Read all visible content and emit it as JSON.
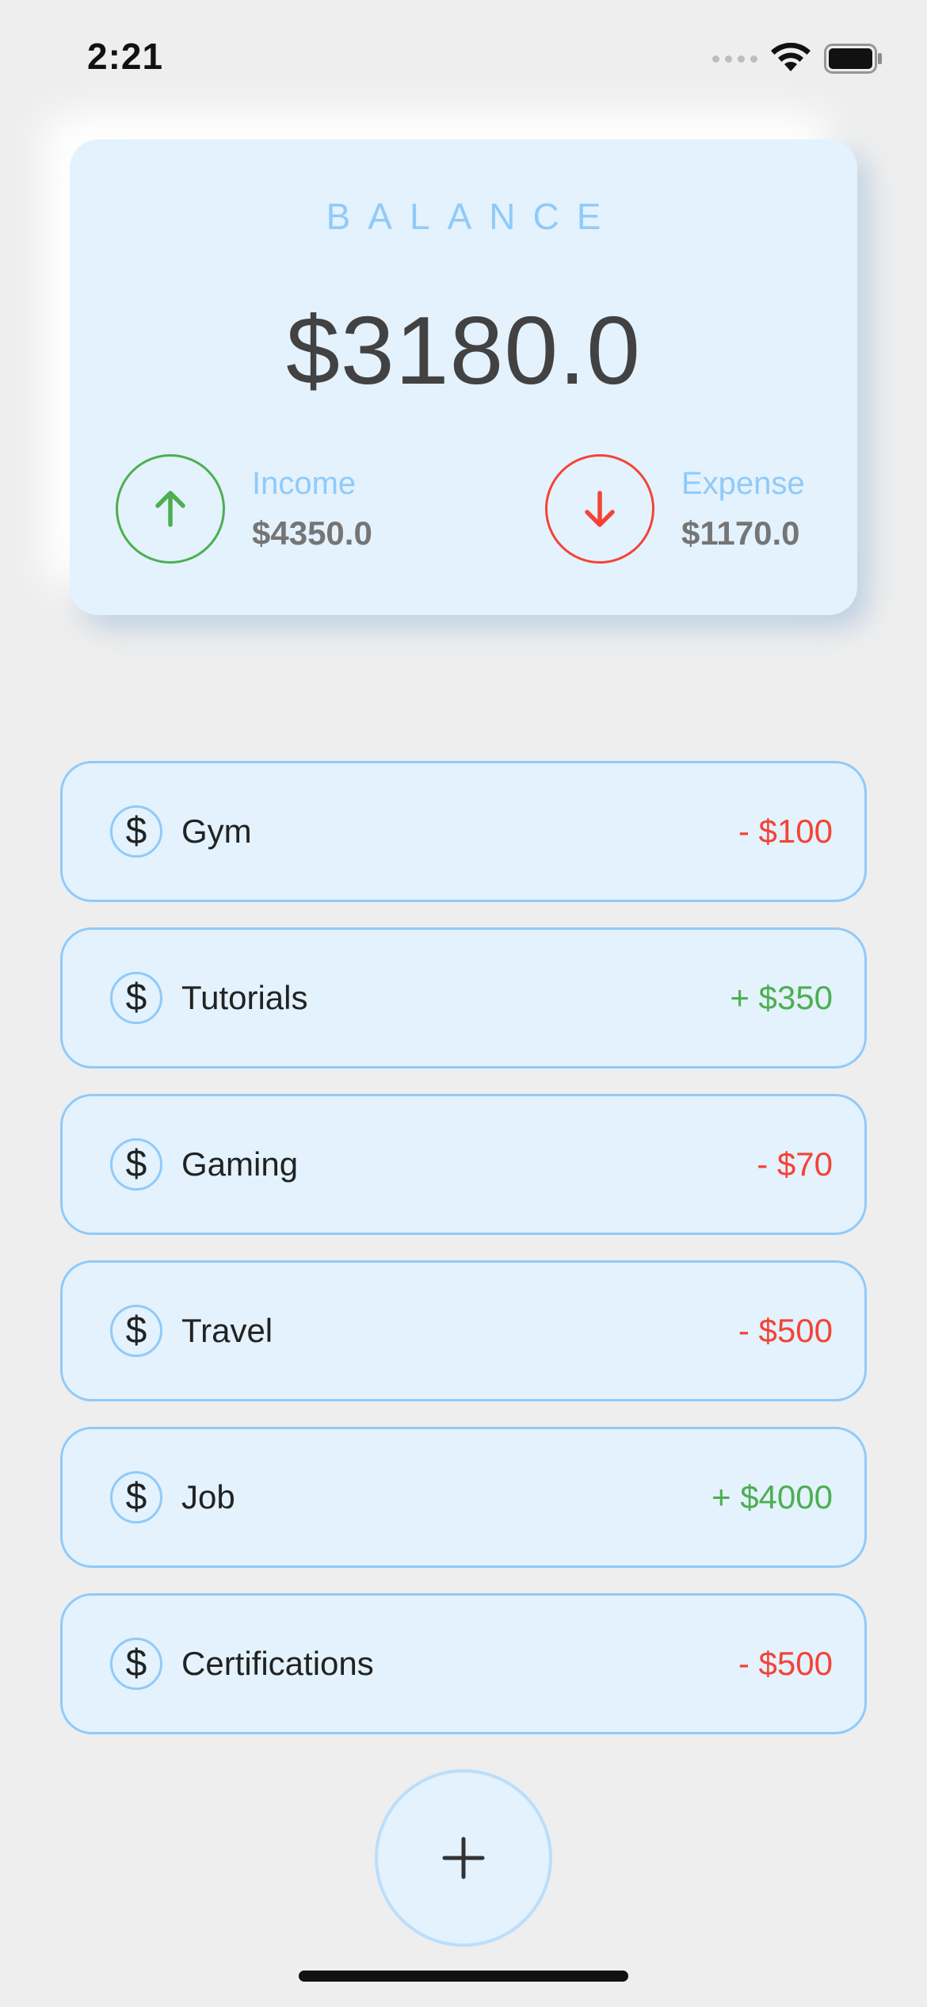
{
  "status_bar": {
    "time": "2:21",
    "icons": [
      "signal-dots-icon",
      "wifi-icon",
      "battery-icon"
    ]
  },
  "balance_card": {
    "label": "BALANCE",
    "amount": "$3180.0",
    "income": {
      "label": "Income",
      "value": "$4350.0",
      "icon": "arrow-up-icon",
      "color": "#4caf50"
    },
    "expense": {
      "label": "Expense",
      "value": "$1170.0",
      "icon": "arrow-down-icon",
      "color": "#f44336"
    }
  },
  "transactions": [
    {
      "name": "Gym",
      "amount": "- $100",
      "type": "expense"
    },
    {
      "name": "Tutorials",
      "amount": "+ $350",
      "type": "income"
    },
    {
      "name": "Gaming",
      "amount": "- $70",
      "type": "expense"
    },
    {
      "name": "Travel",
      "amount": "- $500",
      "type": "expense"
    },
    {
      "name": "Job",
      "amount": "+ $4000",
      "type": "income"
    },
    {
      "name": "Certifications",
      "amount": "- $500",
      "type": "expense"
    }
  ],
  "transaction_icon": "dollar-icon",
  "transaction_icon_glyph": "$",
  "add_button": {
    "icon": "plus-icon"
  },
  "colors": {
    "background": "#eeeeee",
    "card": "#e3f2fd",
    "accent": "#90caf9",
    "income": "#4caf50",
    "expense": "#f44336"
  }
}
